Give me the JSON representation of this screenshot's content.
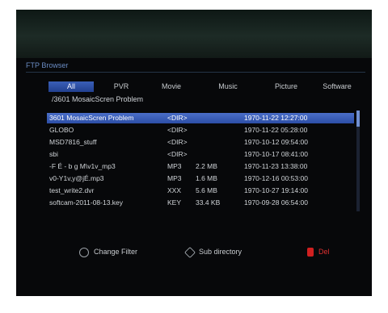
{
  "screen": {
    "title": "FTP Browser",
    "tabs": [
      "All",
      "PVR",
      "Movie",
      "Music",
      "Picture",
      "Software"
    ],
    "active_tab": "All",
    "path": "/3601 MosaicScren Problem"
  },
  "files": [
    {
      "name": "3601 MosaicScren Problem",
      "type": "<DIR>",
      "size": "",
      "date": "1970-11-22 12:27:00"
    },
    {
      "name": "GLOBO",
      "type": "<DIR>",
      "size": "",
      "date": "1970-11-22 05:28:00"
    },
    {
      "name": "MSD7816_stuff",
      "type": "<DIR>",
      "size": "",
      "date": "1970-10-12 09:54:00"
    },
    {
      "name": "sbi",
      "type": "<DIR>",
      "size": "",
      "date": "1970-10-17 08:41:00"
    },
    {
      "name": "-F É - b g M\\v1v_mp3",
      "type": "MP3",
      "size": "2.2 MB",
      "date": "1970-11-23 13:38:00"
    },
    {
      "name": "v0-Y1v,y@jÉ.mp3",
      "type": "MP3",
      "size": "1.6 MB",
      "date": "1970-12-16 00:53:00"
    },
    {
      "name": "test_write2.dvr",
      "type": "XXX",
      "size": "5.6 MB",
      "date": "1970-10-27 19:14:00"
    },
    {
      "name": "softcam-2011-08-13.key",
      "type": "KEY",
      "size": "33.4 KB",
      "date": "1970-09-28 06:54:00"
    }
  ],
  "footer": {
    "change_filter": "Change Filter",
    "sub_directory": "Sub directory",
    "delete": "Del"
  }
}
